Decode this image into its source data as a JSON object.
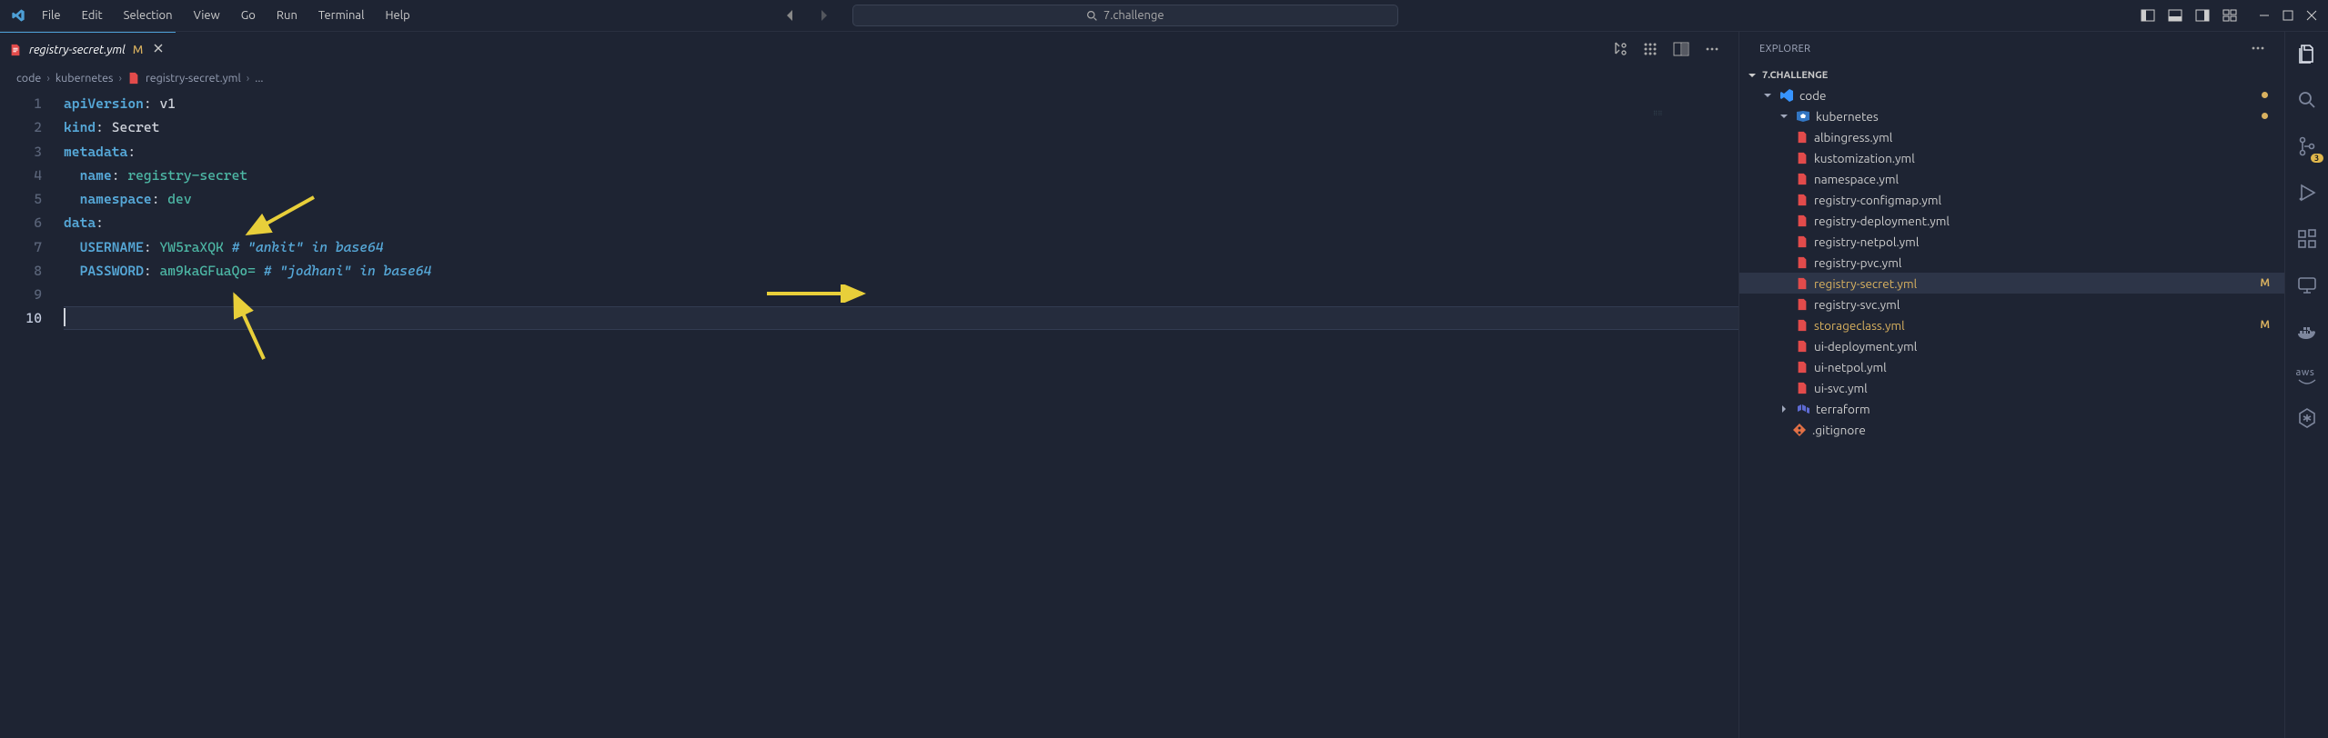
{
  "menus": [
    "File",
    "Edit",
    "Selection",
    "View",
    "Go",
    "Run",
    "Terminal",
    "Help"
  ],
  "search_box": "7.challenge",
  "tab": {
    "label": "registry-secret.yml",
    "modified": "M"
  },
  "breadcrumb": {
    "a": "code",
    "b": "kubernetes",
    "c": "registry-secret.yml",
    "d": "..."
  },
  "lines": [
    "1",
    "2",
    "3",
    "4",
    "5",
    "6",
    "7",
    "8",
    "9",
    "10"
  ],
  "code": {
    "l1_key": "apiVersion",
    "l1_col": ": ",
    "l1_val": "v1",
    "l2_key": "kind",
    "l2_col": ": ",
    "l2_val": "Secret",
    "l3_key": "metadata",
    "l3_col": ":",
    "l4_ind": "  ",
    "l4_key": "name",
    "l4_col": ": ",
    "l4_val": "registry-secret",
    "l5_ind": "  ",
    "l5_key": "namespace",
    "l5_col": ": ",
    "l5_val": "dev",
    "l6_key": "data",
    "l6_col": ":",
    "l7_ind": "  ",
    "l7_key": "USERNAME",
    "l7_col": ": ",
    "l7_val": "YW5raXQK",
    "l7_sp": " ",
    "l7_cmt": "# \"ankit\" in base64",
    "l8_ind": "  ",
    "l8_key": "PASSWORD",
    "l8_col": ": ",
    "l8_val": "am9kaGFuaQo=",
    "l8_sp": " ",
    "l8_cmt": "# \"jodhani\" in base64"
  },
  "explorer_title": "EXPLORER",
  "section_title": "7.CHALLENGE",
  "tree": {
    "root": "code",
    "folder1": "kubernetes",
    "files": [
      "albingress.yml",
      "kustomization.yml",
      "namespace.yml",
      "registry-configmap.yml",
      "registry-deployment.yml",
      "registry-netpol.yml",
      "registry-pvc.yml",
      "registry-secret.yml",
      "registry-svc.yml",
      "storageclass.yml",
      "ui-deployment.yml",
      "ui-netpol.yml",
      "ui-svc.yml"
    ],
    "folder2": "terraform",
    "gitignore": ".gitignore"
  },
  "mod_m": "M",
  "badge_scm": "3",
  "aws_label": "aws"
}
